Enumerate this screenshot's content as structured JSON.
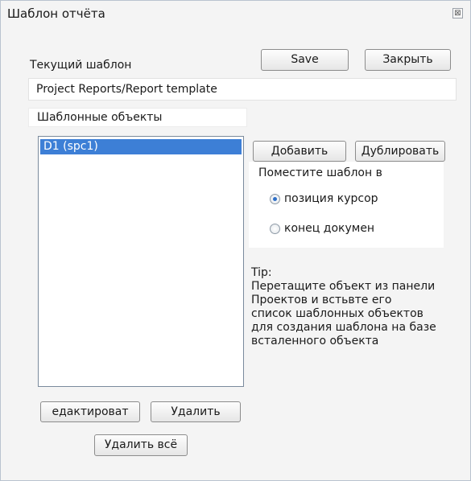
{
  "window": {
    "title": "Шаблон отчёта",
    "close_symbol": "⊠"
  },
  "current_template": {
    "label": "Текущий шаблон",
    "value": "Project Reports/Report template"
  },
  "buttons": {
    "save": "Save",
    "close": "Закрыть",
    "add": "Добавить",
    "duplicate": "Дублировать",
    "edit": "едактироват",
    "delete": "Удалить",
    "delete_all": "Удалить всё"
  },
  "template_objects": {
    "label": "Шаблонные объекты",
    "items": [
      "D1 (spc1)"
    ]
  },
  "placement": {
    "label": "Поместите шаблон в",
    "options": [
      {
        "label": "позиция курсор",
        "checked": true
      },
      {
        "label": "конец докумен",
        "checked": false
      }
    ]
  },
  "tip": {
    "heading": "Tip:",
    "lines": [
      "Перетащите объект из панели",
      "Проектов и встьвте его",
      "список шаблонных объектов",
      "для создания шаблона на базе",
      "всталенного объекта"
    ]
  },
  "colors": {
    "selection": "#3d7fd6",
    "radio_dot": "#2e6fc8"
  }
}
